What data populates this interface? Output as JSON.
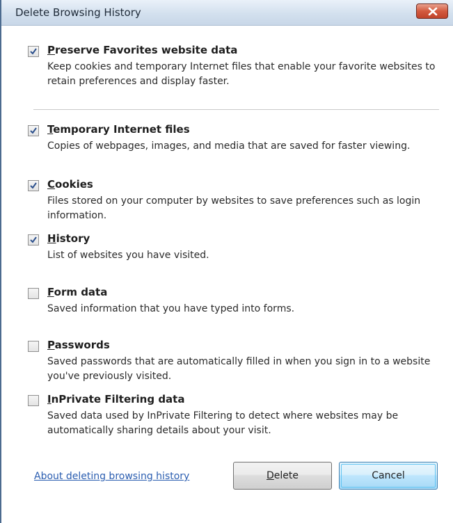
{
  "window": {
    "title": "Delete Browsing History",
    "close_icon": "close-icon"
  },
  "options": [
    {
      "id": "preserve-favorites",
      "label_first": "P",
      "label_rest": "reserve Favorites website data",
      "description": "Keep cookies and temporary Internet files that enable your favorite websites to retain preferences and display faster.",
      "checked": true
    },
    {
      "id": "temporary-internet-files",
      "label_first": "T",
      "label_rest": "emporary Internet files",
      "description": "Copies of webpages, images, and media that are saved for faster viewing.",
      "checked": true
    },
    {
      "id": "cookies",
      "label_first": "C",
      "label_rest": "ookies",
      "description": "Files stored on your computer by websites to save preferences such as login information.",
      "checked": true
    },
    {
      "id": "history",
      "label_first": "H",
      "label_rest": "istory",
      "description": "List of websites you have visited.",
      "checked": true
    },
    {
      "id": "form-data",
      "label_first": "F",
      "label_rest": "orm data",
      "description": "Saved information that you have typed into forms.",
      "checked": false
    },
    {
      "id": "passwords",
      "label_first": "P",
      "label_rest": "asswords",
      "description": "Saved passwords that are automatically filled in when you sign in to a website you've previously visited.",
      "checked": false
    },
    {
      "id": "inprivate-filtering-data",
      "label_first": "I",
      "label_rest": "nPrivate Filtering data",
      "description": "Saved data used by InPrivate Filtering to detect where websites may be automatically sharing details about your visit.",
      "checked": false
    }
  ],
  "footer": {
    "about_link": "About deleting browsing history",
    "delete_first": "D",
    "delete_rest": "elete",
    "cancel_label": "Cancel"
  },
  "colors": {
    "link": "#2a5db0",
    "title_bar": "#d3e0ee",
    "close_button": "#d35a3f",
    "default_button_border": "#3c7fb1"
  }
}
